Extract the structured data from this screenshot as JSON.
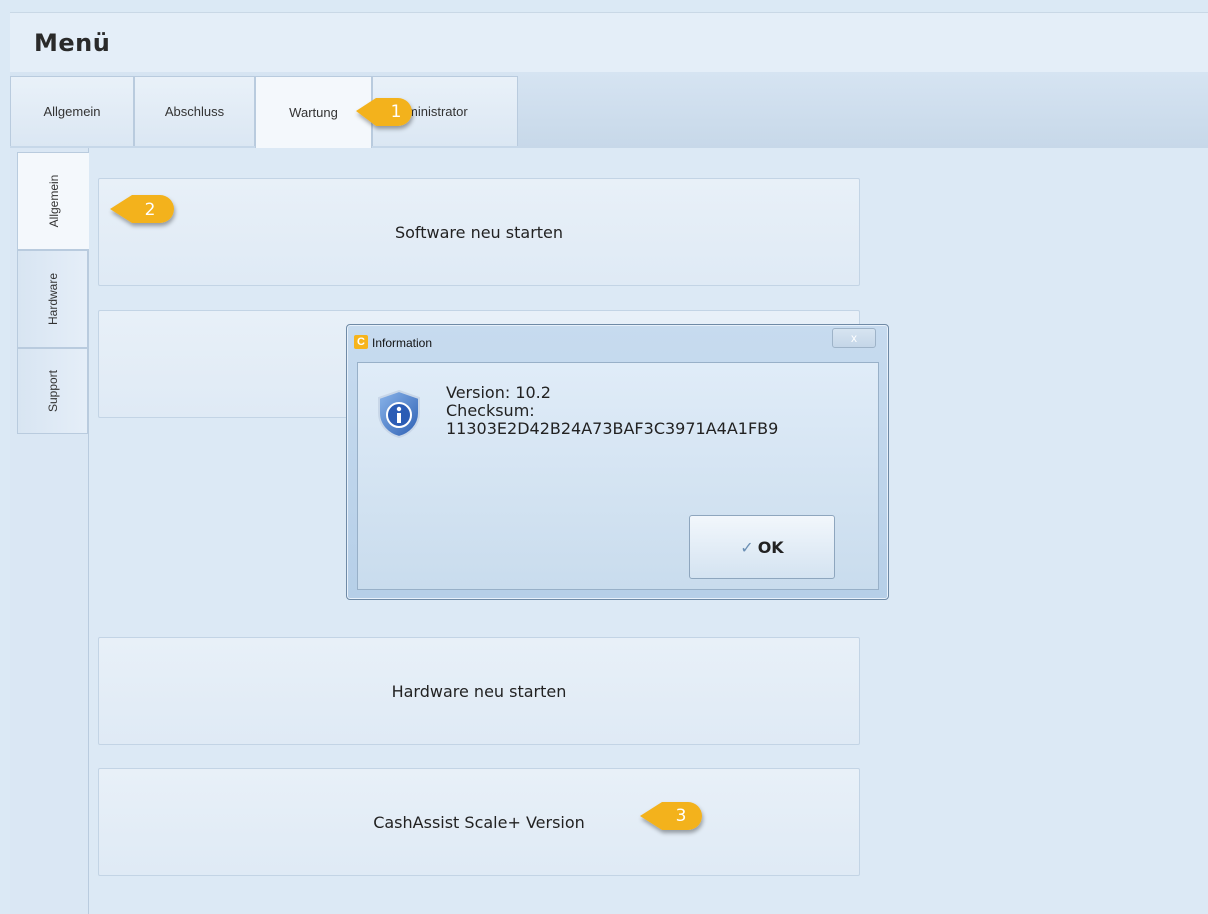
{
  "header": {
    "title": "Menü"
  },
  "top_tabs": [
    {
      "label": "Allgemein"
    },
    {
      "label": "Abschluss"
    },
    {
      "label": "Wartung",
      "active": true
    },
    {
      "label": "ministrator"
    }
  ],
  "side_tabs": [
    {
      "label": "Allgemein",
      "active": true
    },
    {
      "label": "Hardware"
    },
    {
      "label": "Support"
    }
  ],
  "buttons": {
    "software_restart": "Software neu starten",
    "hardware_restart": "Hardware neu starten",
    "version": "CashAssist Scale+ Version"
  },
  "callouts": [
    "1",
    "2",
    "3"
  ],
  "dialog": {
    "app_icon": "C",
    "title": "Information",
    "close": "x",
    "version_line": "Version: 10.2",
    "checksum_label": "Checksum:",
    "checksum_value": "11303E2D42B24A73BAF3C3971A4A1FB9",
    "ok_label": "OK"
  },
  "colors": {
    "callout": "#f3b21e",
    "accent": "#6f8aa6"
  }
}
